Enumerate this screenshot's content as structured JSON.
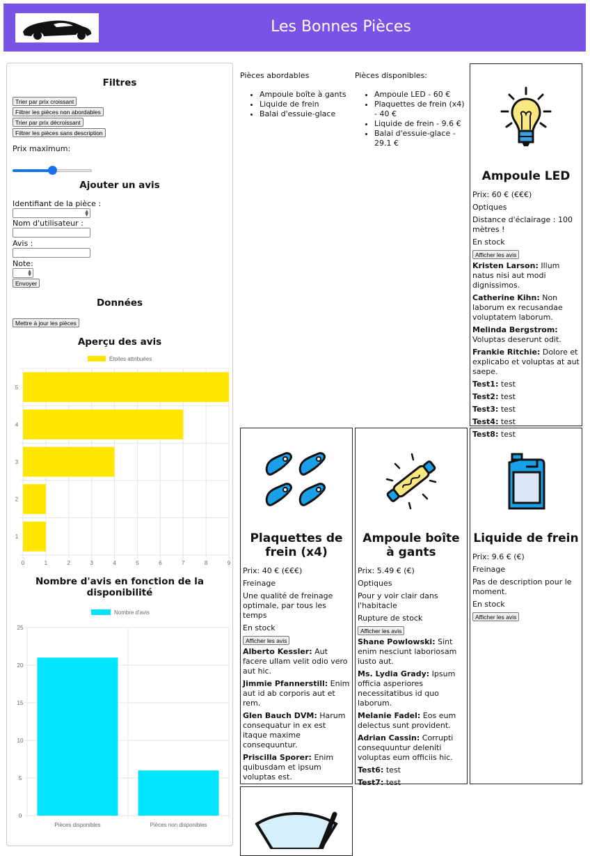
{
  "header": {
    "title": "Les Bonnes Pièces"
  },
  "filters": {
    "title": "Filtres",
    "buttons": [
      "Trier par prix croissant",
      "Filtrer les pièces non abordables",
      "Trier par prix décroissant",
      "Filtrer les pièces sans description"
    ],
    "price_max_label": "Prix maximum:",
    "price_max_fraction": 0.5
  },
  "review_form": {
    "title": "Ajouter un avis",
    "piece_id_label": "Identifiant de la pièce :",
    "username_label": "Nom d'utilisateur :",
    "review_label": "Avis :",
    "rating_label": "Note:",
    "submit": "Envoyer"
  },
  "data_section": {
    "title": "Données",
    "update_button": "Mettre à jour les pièces"
  },
  "affordable": {
    "title": "Pièces abordables",
    "items": [
      "Ampoule boîte à gants",
      "Liquide de frein",
      "Balai d'essuie-glace"
    ]
  },
  "available": {
    "title": "Pièces disponibles:",
    "items": [
      "Ampoule LED - 60 €",
      "Plaquettes de frein (x4) - 40 €",
      "Liquide de frein - 9.6 €",
      "Balai d'essuie-glace - 29.1 €"
    ]
  },
  "show_reviews_label": "Afficher les avis",
  "cards": [
    {
      "name": "Ampoule LED",
      "price": "Prix: 60 € (€€€)",
      "category": "Optiques",
      "description": "Distance d'éclairage : 100 mètres !",
      "stock": "En stock",
      "reviews": [
        {
          "user": "Kristen Larson:",
          "text": "Illum natus nisi aut modi dignissimos."
        },
        {
          "user": "Catherine Kihn:",
          "text": "Non laborum ex recusandae voluptatem laborum."
        },
        {
          "user": "Melinda Bergstrom:",
          "text": "Voluptas deserunt odit."
        },
        {
          "user": "Frankie Ritchie:",
          "text": "Dolore et explicabo et voluptas at aut saepe."
        },
        {
          "user": "Test1:",
          "text": "test"
        },
        {
          "user": "Test2:",
          "text": "test"
        },
        {
          "user": "Test3:",
          "text": "test"
        },
        {
          "user": "Test4:",
          "text": "test"
        },
        {
          "user": "Test8:",
          "text": "test"
        }
      ]
    },
    {
      "name": "Plaquettes de frein (x4)",
      "price": "Prix: 40 € (€€€)",
      "category": "Freinage",
      "description": "Une qualité de freinage optimale, par tous les temps",
      "stock": "En stock",
      "reviews": [
        {
          "user": "Alberto Kessler:",
          "text": "Aut facere ullam velit odio vero aut hic."
        },
        {
          "user": "Jimmie Pfannerstill:",
          "text": "Enim aut id ab corporis aut et rem."
        },
        {
          "user": "Glen Bauch DVM:",
          "text": "Harum consequatur in ex est itaque maxime consequuntur."
        },
        {
          "user": "Priscilla Sporer:",
          "text": "Enim quibusdam et ipsum voluptas est."
        }
      ]
    },
    {
      "name": "Ampoule boîte à gants",
      "price": "Prix: 5.49 € (€)",
      "category": "Optiques",
      "description": "Pour y voir clair dans l'habitacle",
      "stock": "Rupture de stock",
      "reviews": [
        {
          "user": "Shane Powlowski:",
          "text": "Sint enim nesciunt laboriosam iusto aut."
        },
        {
          "user": "Ms. Lydia Grady:",
          "text": "Ipsum officia asperiores necessitatibus id quo laborum."
        },
        {
          "user": "Melanie Fadel:",
          "text": "Eos eum delectus sunt provident."
        },
        {
          "user": "Adrian Cassin:",
          "text": "Corrupti consequuntur deleniti voluptas eum officiis hic."
        },
        {
          "user": "Test6:",
          "text": "test"
        },
        {
          "user": "Test7:",
          "text": "test"
        }
      ]
    },
    {
      "name": "Liquide de frein",
      "price": "Prix: 9.6 € (€)",
      "category": "Freinage",
      "description": "Pas de description pour le moment.",
      "stock": "En stock",
      "reviews": []
    }
  ],
  "charts_text": {
    "ratings_title": "Aperçu des avis",
    "availability_title": "Nombre d'avis en fonction de la disponibilité"
  },
  "chart_data": [
    {
      "type": "bar",
      "orientation": "horizontal",
      "title": "Aperçu des avis",
      "categories": [
        "5",
        "4",
        "3",
        "2",
        "1"
      ],
      "series": [
        {
          "name": "Étoiles attribuées",
          "values": [
            9,
            7,
            4,
            1,
            1
          ]
        }
      ],
      "xlim": [
        0,
        9
      ],
      "xticks": [
        "0",
        "1",
        "2",
        "3",
        "4",
        "5",
        "6",
        "7",
        "8",
        "9"
      ],
      "color": "#ffe600",
      "legend": "top",
      "grid": true
    },
    {
      "type": "bar",
      "orientation": "vertical",
      "title": "Nombre d'avis en fonction de la disponibilité",
      "categories": [
        "Pièces disponibles",
        "Pièces non disponibles"
      ],
      "series": [
        {
          "name": "Nombre d'avis",
          "values": [
            21,
            6
          ]
        }
      ],
      "ylim": [
        0,
        25
      ],
      "yticks": [
        "0",
        "5",
        "10",
        "15",
        "20",
        "25"
      ],
      "color": "#00e5ff",
      "legend": "top",
      "grid": true
    }
  ]
}
